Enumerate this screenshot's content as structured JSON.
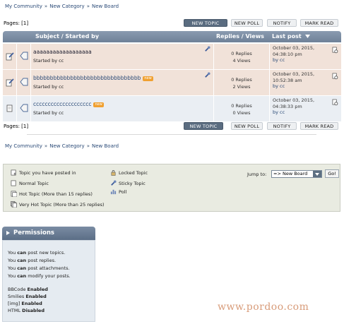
{
  "breadcrumb": {
    "items": [
      "My Community",
      "New Category",
      "New Board"
    ],
    "separator": "»"
  },
  "pagination": {
    "label": "Pages: [1]"
  },
  "buttons": {
    "new_topic": "NEW TOPIC",
    "new_poll": "NEW POLL",
    "notify": "NOTIFY",
    "mark_read": "MARK READ"
  },
  "table": {
    "headers": {
      "subject": "Subject / Started by",
      "replies": "Replies / Views",
      "last_post": "Last post"
    },
    "topics": [
      {
        "title": "aaaaaaaaaaaaaaaaaa",
        "started_by": "Started by cc",
        "is_new": false,
        "new_label": "",
        "sticky": true,
        "replies": "0 Replies",
        "views": "4 Views",
        "last_post_date": "October 03, 2015,",
        "last_post_time": "04:38:10 pm",
        "last_post_by": "by cc"
      },
      {
        "title": "bbbbbbbbbbbbbbbbbbbbbbbbbbbbbbbb",
        "started_by": "Started by cc",
        "is_new": true,
        "new_label": "new",
        "sticky": true,
        "replies": "0 Replies",
        "views": "2 Views",
        "last_post_date": "October 03, 2015,",
        "last_post_time": "10:52:38 am",
        "last_post_by": "by cc"
      },
      {
        "title": "cccccccccccccccccccc",
        "started_by": "Started by cc",
        "is_new": true,
        "new_label": "new",
        "sticky": false,
        "replies": "0 Replies",
        "views": "0 Views",
        "last_post_date": "October 03, 2015,",
        "last_post_time": "04:38:33 pm",
        "last_post_by": "by cc"
      }
    ]
  },
  "legend": {
    "items": [
      "Topic you have posted in",
      "Normal Topic",
      "Hot Topic (More than 15 replies)",
      "Very Hot Topic (More than 25 replies)",
      "Locked Topic",
      "Sticky Topic",
      "Poll"
    ],
    "jump_label": "Jump to:",
    "jump_value": "=> New Board",
    "go_label": "Go!"
  },
  "permissions": {
    "title": "Permissions",
    "lines": [
      {
        "pre": "You ",
        "bold": "can",
        "post": " post new topics."
      },
      {
        "pre": "You ",
        "bold": "can",
        "post": " post replies."
      },
      {
        "pre": "You ",
        "bold": "can",
        "post": " post attachments."
      },
      {
        "pre": "You ",
        "bold": "can",
        "post": " modify your posts."
      }
    ],
    "features": [
      {
        "name": "BBCode",
        "status": "Enabled"
      },
      {
        "name": "Smilies",
        "status": "Enabled"
      },
      {
        "name": "[img]",
        "status": "Enabled"
      },
      {
        "name": "HTML",
        "status": "Disabled"
      }
    ]
  },
  "watermark": "www.pordoo.com",
  "colors": {
    "header_bg": "#7d8fa6",
    "row_pink": "#f1e2d9",
    "row_blue": "#eaeef3",
    "new_badge": "#f0a030",
    "legend_bg": "#e9ebe1",
    "permissions_bg": "#e5ebf1"
  }
}
